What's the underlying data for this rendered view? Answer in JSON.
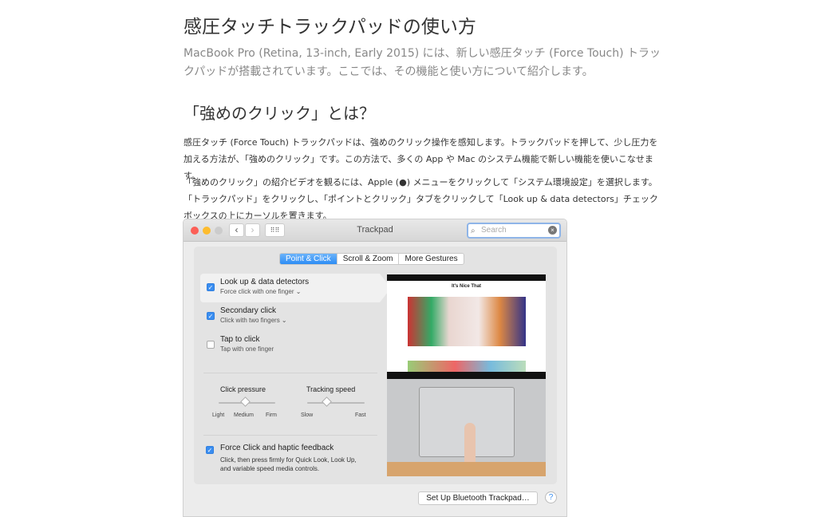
{
  "article": {
    "title": "感圧タッチトラックパッドの使い方",
    "intro": "MacBook Pro (Retina, 13-inch, Early 2015) には、新しい感圧タッチ (Force Touch) トラックパッドが搭載されています。ここでは、その機能と使い方について紹介します。",
    "heading": "「強めのクリック」とは？",
    "para1": "感圧タッチ (Force Touch) トラックパッドは、強めのクリック操作を感知します。トラックパッドを押して、少し圧力を加える方法が、「強めのクリック」です。この方法で、多くの App や Mac のシステム機能で新しい機能を使いこなせます。",
    "para2_before": "「強めのクリック」の紹介ビデオを観るには、Apple (",
    "para2_after": ") メニューをクリックして「システム環境設定」を選択します。「トラックパッド」をクリックし、「ポイントとクリック」タブをクリックして「Look up & data detectors」チェックボックスの上にカーソルを置きます。"
  },
  "window": {
    "title": "Trackpad",
    "search_placeholder": "Search",
    "tabs": [
      {
        "label": "Point & Click",
        "selected": true
      },
      {
        "label": "Scroll & Zoom",
        "selected": false
      },
      {
        "label": "More Gestures",
        "selected": false
      }
    ],
    "options": [
      {
        "label": "Look up & data detectors",
        "sub": "Force click with one finger",
        "checked": true
      },
      {
        "label": "Secondary click",
        "sub": "Click with two fingers",
        "checked": true
      },
      {
        "label": "Tap to click",
        "sub": "Tap with one finger",
        "checked": false
      }
    ],
    "click_pressure": {
      "label": "Click pressure",
      "ticks": [
        "Light",
        "Medium",
        "Firm"
      ],
      "value": "Medium"
    },
    "tracking_speed": {
      "label": "Tracking speed",
      "min": "Slow",
      "max": "Fast",
      "value": 0.35
    },
    "force_click": {
      "label": "Force Click and haptic feedback",
      "desc1": "Click, then press firmly for Quick Look, Look Up,",
      "desc2": "and variable speed media controls.",
      "checked": true
    },
    "preview_site": "It's Nice That",
    "bt_button": "Set Up Bluetooth Trackpad…",
    "help": "?"
  },
  "colors": {
    "accent": "#3b8ef0"
  }
}
